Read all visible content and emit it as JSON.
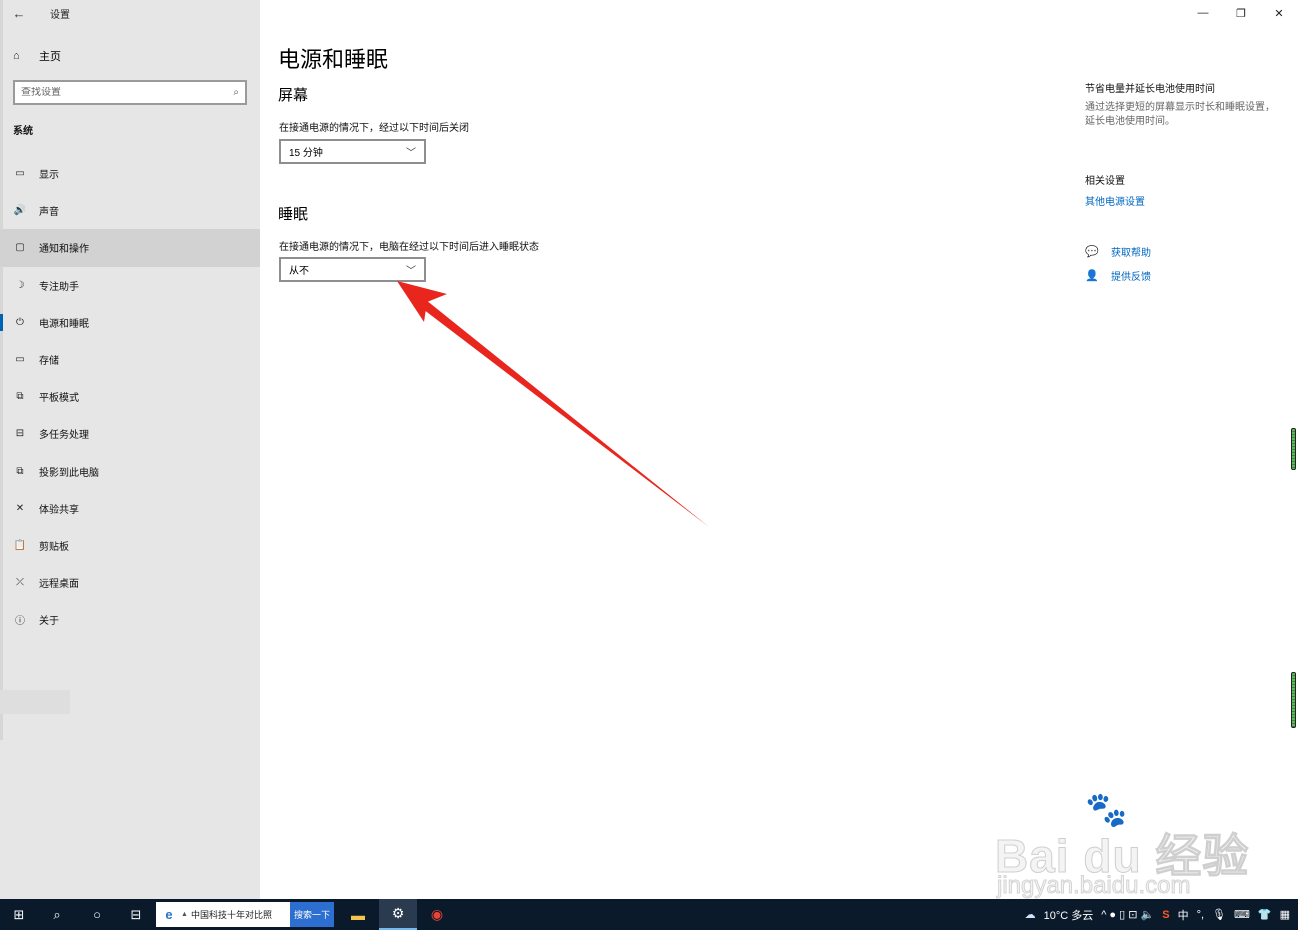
{
  "window": {
    "app_title": "设置",
    "controls": [
      "—",
      "❐",
      "✕"
    ]
  },
  "sidebar": {
    "home_label": "主页",
    "search_placeholder": "查找设置",
    "section": "系统",
    "items": [
      {
        "label": "显示",
        "icon": "monitor-icon",
        "glyph": "▭"
      },
      {
        "label": "声音",
        "icon": "speaker-icon",
        "glyph": "🔊"
      },
      {
        "label": "通知和操作",
        "icon": "notification-icon",
        "glyph": "▢"
      },
      {
        "label": "专注助手",
        "icon": "moon-icon",
        "glyph": "☽"
      },
      {
        "label": "电源和睡眠",
        "icon": "power-icon",
        "glyph": "⏻"
      },
      {
        "label": "存储",
        "icon": "storage-icon",
        "glyph": "▭"
      },
      {
        "label": "平板模式",
        "icon": "tablet-icon",
        "glyph": "⧉"
      },
      {
        "label": "多任务处理",
        "icon": "multitask-icon",
        "glyph": "⊟"
      },
      {
        "label": "投影到此电脑",
        "icon": "project-icon",
        "glyph": "⧉"
      },
      {
        "label": "体验共享",
        "icon": "share-icon",
        "glyph": "✕"
      },
      {
        "label": "剪贴板",
        "icon": "clipboard-icon",
        "glyph": "📋"
      },
      {
        "label": "远程桌面",
        "icon": "remote-icon",
        "glyph": "⤫"
      },
      {
        "label": "关于",
        "icon": "info-icon",
        "glyph": "ⓘ"
      }
    ]
  },
  "main": {
    "title": "电源和睡眠",
    "screen": {
      "heading": "屏幕",
      "desc": "在接通电源的情况下，经过以下时间后关闭",
      "value": "15 分钟"
    },
    "sleep": {
      "heading": "睡眠",
      "desc": "在接通电源的情况下，电脑在经过以下时间后进入睡眠状态",
      "value": "从不"
    }
  },
  "right": {
    "save_heading": "节省电量并延长电池使用时间",
    "save_text": "通过选择更短的屏幕显示时长和睡眠设置，延长电池使用时间。",
    "related_heading": "相关设置",
    "related_link": "其他电源设置",
    "help_label": "获取帮助",
    "feedback_label": "提供反馈"
  },
  "watermark": {
    "main": "Bai du 经验",
    "sub": "jingyan.baidu.com"
  },
  "taskbar": {
    "search_text": "中国科技十年对比照",
    "search_button": "搜索一下",
    "weather": "10°C 多云",
    "ime": "中",
    "tray_glyphs": "^ ● ▯ ⊡ 🔈"
  },
  "colors": {
    "accent": "#0063b1",
    "link": "#0067c0",
    "arrow": "#e8261e",
    "taskbar": "#0b1a2b"
  }
}
